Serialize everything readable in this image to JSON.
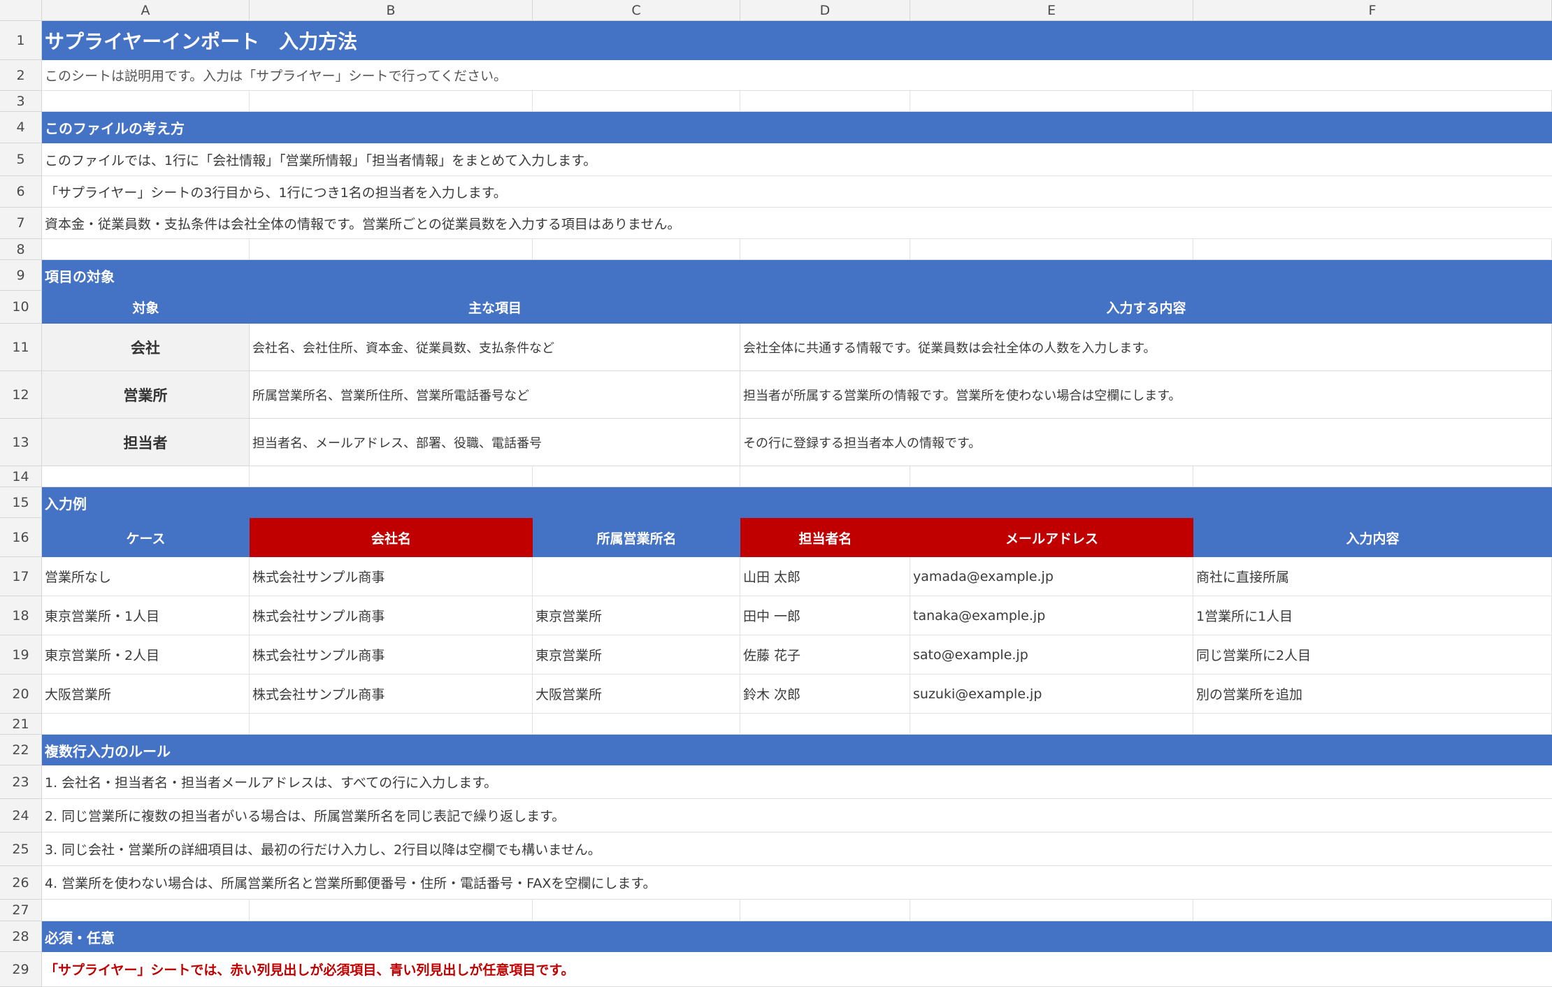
{
  "columns": [
    "A",
    "B",
    "C",
    "D",
    "E",
    "F"
  ],
  "row_numbers": [
    "1",
    "2",
    "3",
    "4",
    "5",
    "6",
    "7",
    "8",
    "9",
    "10",
    "11",
    "12",
    "13",
    "14",
    "15",
    "16",
    "17",
    "18",
    "19",
    "20",
    "21",
    "22",
    "23",
    "24",
    "25",
    "26",
    "27",
    "28",
    "29"
  ],
  "title": "サプライヤーインポート　入力方法",
  "note": "このシートは説明用です。入力は「サプライヤー」シートで行ってください。",
  "sections": {
    "concept": "このファイルの考え方",
    "targets": "項目の対象",
    "examples": "入力例",
    "rules": "複数行入力のルール",
    "required": "必須・任意"
  },
  "concept_lines": [
    "このファイルでは、1行に「会社情報」「営業所情報」「担当者情報」をまとめて入力します。",
    "「サプライヤー」シートの3行目から、1行につき1名の担当者を入力します。",
    "資本金・従業員数・支払条件は会社全体の情報です。営業所ごとの従業員数を入力する項目はありません。"
  ],
  "targets_table": {
    "headers": [
      "対象",
      "主な項目",
      "入力する内容"
    ],
    "rows": [
      {
        "target": "会社",
        "items": "会社名、会社住所、資本金、従業員数、支払条件など",
        "content": "会社全体に共通する情報です。従業員数は会社全体の人数を入力します。"
      },
      {
        "target": "営業所",
        "items": "所属営業所名、営業所住所、営業所電話番号など",
        "content": "担当者が所属する営業所の情報です。営業所を使わない場合は空欄にします。"
      },
      {
        "target": "担当者",
        "items": "担当者名、メールアドレス、部署、役職、電話番号",
        "content": "その行に登録する担当者本人の情報です。"
      }
    ]
  },
  "examples_table": {
    "headers": [
      {
        "label": "ケース",
        "required": false
      },
      {
        "label": "会社名",
        "required": true
      },
      {
        "label": "所属営業所名",
        "required": false
      },
      {
        "label": "担当者名",
        "required": true
      },
      {
        "label": "メールアドレス",
        "required": true
      },
      {
        "label": "入力内容",
        "required": false
      }
    ],
    "rows": [
      [
        "営業所なし",
        "株式会社サンプル商事",
        "",
        "山田 太郎",
        "yamada@example.jp",
        "商社に直接所属"
      ],
      [
        "東京営業所・1人目",
        "株式会社サンプル商事",
        "東京営業所",
        "田中 一郎",
        "tanaka@example.jp",
        "1営業所に1人目"
      ],
      [
        "東京営業所・2人目",
        "株式会社サンプル商事",
        "東京営業所",
        "佐藤 花子",
        "sato@example.jp",
        "同じ営業所に2人目"
      ],
      [
        "大阪営業所",
        "株式会社サンプル商事",
        "大阪営業所",
        "鈴木 次郎",
        "suzuki@example.jp",
        "別の営業所を追加"
      ]
    ]
  },
  "rules_lines": [
    "1. 会社名・担当者名・担当者メールアドレスは、すべての行に入力します。",
    "2. 同じ営業所に複数の担当者がいる場合は、所属営業所名を同じ表記で繰り返します。",
    "3. 同じ会社・営業所の詳細項目は、最初の行だけ入力し、2行目以降は空欄でも構いません。",
    "4. 営業所を使わない場合は、所属営業所名と営業所郵便番号・住所・電話番号・FAXを空欄にします。"
  ],
  "required_note": "「サプライヤー」シートでは、赤い列見出しが必須項目、青い列見出しが任意項目です。",
  "colors": {
    "section_blue": "#4472c4",
    "required_red": "#c00000",
    "header_gray": "#f3f3f3"
  }
}
